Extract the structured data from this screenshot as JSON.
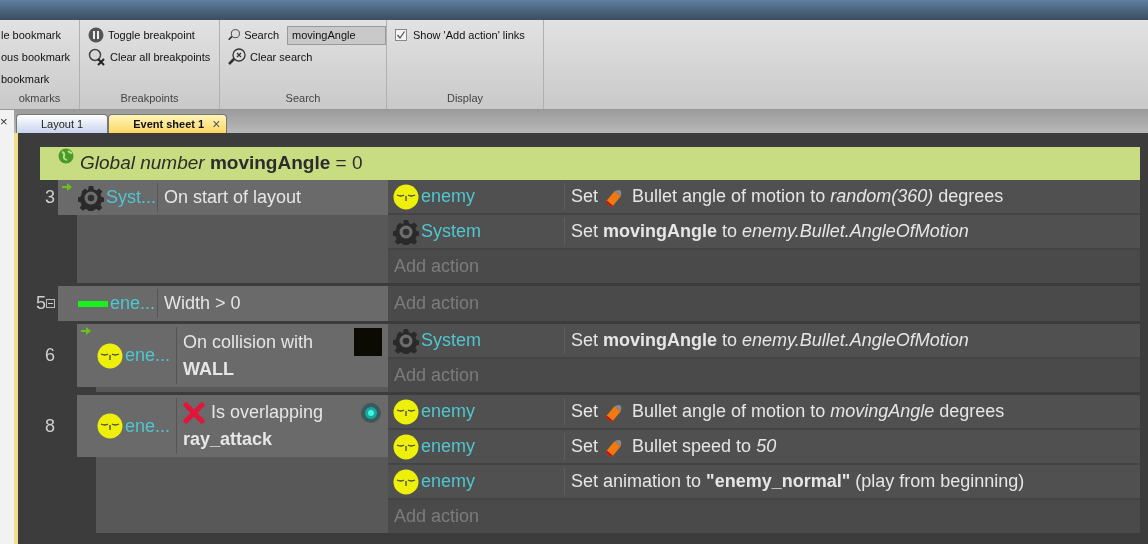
{
  "ribbon": [
    {
      "label": "okmarks",
      "items": [
        {
          "kind": "button",
          "label": "le bookmark"
        },
        {
          "kind": "button",
          "label": "ous bookmark"
        },
        {
          "kind": "button",
          "label": "bookmark"
        }
      ]
    },
    {
      "label": "Breakpoints",
      "items": [
        {
          "kind": "button",
          "label": "Toggle breakpoint"
        },
        {
          "kind": "button",
          "label": "Clear all breakpoints"
        }
      ]
    },
    {
      "label": "Search",
      "items": [
        {
          "kind": "search",
          "label": "Search",
          "value": "movingAngle"
        },
        {
          "kind": "button",
          "label": "Clear search"
        }
      ]
    },
    {
      "label": "Display",
      "items": [
        {
          "kind": "checkbox",
          "label": "Show 'Add action' links",
          "checked": true
        }
      ]
    }
  ],
  "panel_close": "×",
  "tabs": [
    {
      "label": "Layout 1",
      "selected": false
    },
    {
      "label": "Event sheet 1",
      "selected": true,
      "close": "×"
    }
  ],
  "global_variable": "*Global number* **movingAngle** = 0",
  "events": [
    {
      "number": "3",
      "conditions": [
        {
          "kind": "system",
          "object": "Syst...",
          "trigger": true,
          "inverted": false,
          "text": "On start of layout"
        }
      ],
      "actions": [
        {
          "kind": "behavior",
          "object": "enemy",
          "lead": "Set",
          "text": "Bullet angle of motion to *random(360)* degrees"
        },
        {
          "kind": "system",
          "object": "System",
          "text": "Set **movingAngle** to *enemy.Bullet.AngleOfMotion*"
        }
      ],
      "add_action": "Add action"
    },
    {
      "number": "5",
      "expanded": true,
      "conditions": [
        {
          "kind": "bar",
          "object": "ene...",
          "trigger": false,
          "inverted": false,
          "text": "Width > 0"
        }
      ],
      "add_action": "Add action",
      "children": [
        {
          "number": "6",
          "conditions": [
            {
              "kind": "collision",
              "object": "ene...",
              "trigger": true,
              "inverted": false,
              "text": "On collision with",
              "param": "WALL"
            }
          ],
          "actions": [
            {
              "kind": "system",
              "object": "System",
              "text": "Set **movingAngle** to *enemy.Bullet.AngleOfMotion*"
            }
          ],
          "add_action": "Add action"
        },
        {
          "number": "8",
          "conditions": [
            {
              "kind": "overlap",
              "object": "ene...",
              "trigger": false,
              "inverted": true,
              "text": "Is overlapping",
              "param": "ray_attack"
            }
          ],
          "actions": [
            {
              "kind": "behavior",
              "object": "enemy",
              "lead": "Set",
              "text": "Bullet angle of motion to *movingAngle* degrees"
            },
            {
              "kind": "behavior",
              "object": "enemy",
              "lead": "Set",
              "text": "Bullet speed to *50*"
            },
            {
              "kind": "sprite",
              "object": "enemy",
              "text": "Set animation to **\"enemy_normal\"** (play from beginning)"
            }
          ],
          "add_action": "Add action"
        }
      ]
    }
  ]
}
